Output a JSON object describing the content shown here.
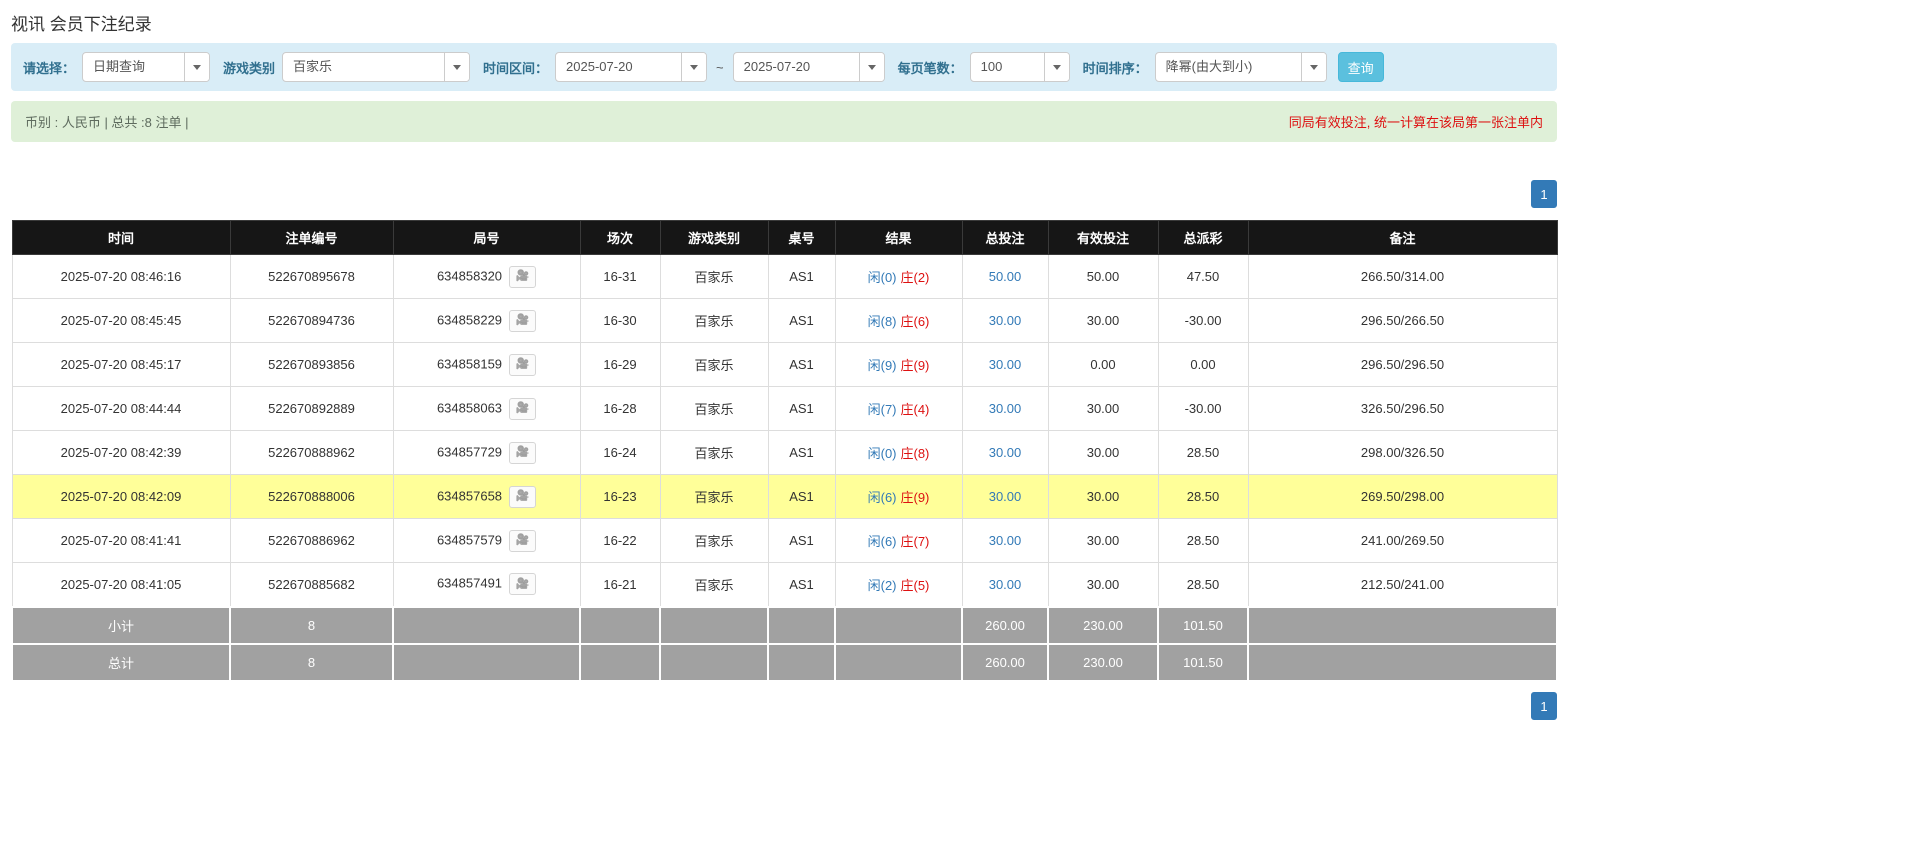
{
  "page_title": "视讯 会员下注纪录",
  "filter": {
    "select_label": "请选择：",
    "select_value": "日期查询",
    "game_type_label": "游戏类别",
    "game_type_value": "百家乐",
    "time_range_label": "时间区间：",
    "date_from": "2025-07-20",
    "tilde": "~",
    "date_to": "2025-07-20",
    "page_size_label": "每页笔数：",
    "page_size_value": "100",
    "sort_label": "时间排序：",
    "sort_value": "降幂(由大到小)",
    "search_button": "查询"
  },
  "summary": {
    "left": "币别 : 人民币 | 总共 :8 注单 |",
    "right": "同局有效投注, 统一计算在该局第一张注单内"
  },
  "pagination": {
    "page": "1"
  },
  "table": {
    "headers": [
      "时间",
      "注单编号",
      "局号",
      "场次",
      "游戏类别",
      "桌号",
      "结果",
      "总投注",
      "有效投注",
      "总派彩",
      "备注"
    ],
    "rows": [
      {
        "time": "2025-07-20 08:46:16",
        "bet_id": "522670895678",
        "round": "634858320",
        "session": "16-31",
        "game": "百家乐",
        "table_no": "AS1",
        "result_player": "闲(0)",
        "result_banker": "庄(2)",
        "total_bet": "50.00",
        "valid_bet": "50.00",
        "payout": "47.50",
        "note": "266.50/314.00",
        "highlight": false
      },
      {
        "time": "2025-07-20 08:45:45",
        "bet_id": "522670894736",
        "round": "634858229",
        "session": "16-30",
        "game": "百家乐",
        "table_no": "AS1",
        "result_player": "闲(8)",
        "result_banker": "庄(6)",
        "total_bet": "30.00",
        "valid_bet": "30.00",
        "payout": "-30.00",
        "note": "296.50/266.50",
        "highlight": false
      },
      {
        "time": "2025-07-20 08:45:17",
        "bet_id": "522670893856",
        "round": "634858159",
        "session": "16-29",
        "game": "百家乐",
        "table_no": "AS1",
        "result_player": "闲(9)",
        "result_banker": "庄(9)",
        "total_bet": "30.00",
        "valid_bet": "0.00",
        "payout": "0.00",
        "note": "296.50/296.50",
        "highlight": false
      },
      {
        "time": "2025-07-20 08:44:44",
        "bet_id": "522670892889",
        "round": "634858063",
        "session": "16-28",
        "game": "百家乐",
        "table_no": "AS1",
        "result_player": "闲(7)",
        "result_banker": "庄(4)",
        "total_bet": "30.00",
        "valid_bet": "30.00",
        "payout": "-30.00",
        "note": "326.50/296.50",
        "highlight": false
      },
      {
        "time": "2025-07-20 08:42:39",
        "bet_id": "522670888962",
        "round": "634857729",
        "session": "16-24",
        "game": "百家乐",
        "table_no": "AS1",
        "result_player": "闲(0)",
        "result_banker": "庄(8)",
        "total_bet": "30.00",
        "valid_bet": "30.00",
        "payout": "28.50",
        "note": "298.00/326.50",
        "highlight": false
      },
      {
        "time": "2025-07-20 08:42:09",
        "bet_id": "522670888006",
        "round": "634857658",
        "session": "16-23",
        "game": "百家乐",
        "table_no": "AS1",
        "result_player": "闲(6)",
        "result_banker": "庄(9)",
        "total_bet": "30.00",
        "valid_bet": "30.00",
        "payout": "28.50",
        "note": "269.50/298.00",
        "highlight": true
      },
      {
        "time": "2025-07-20 08:41:41",
        "bet_id": "522670886962",
        "round": "634857579",
        "session": "16-22",
        "game": "百家乐",
        "table_no": "AS1",
        "result_player": "闲(6)",
        "result_banker": "庄(7)",
        "total_bet": "30.00",
        "valid_bet": "30.00",
        "payout": "28.50",
        "note": "241.00/269.50",
        "highlight": false
      },
      {
        "time": "2025-07-20 08:41:05",
        "bet_id": "522670885682",
        "round": "634857491",
        "session": "16-21",
        "game": "百家乐",
        "table_no": "AS1",
        "result_player": "闲(2)",
        "result_banker": "庄(5)",
        "total_bet": "30.00",
        "valid_bet": "30.00",
        "payout": "28.50",
        "note": "212.50/241.00",
        "highlight": false
      }
    ],
    "subtotal": {
      "label": "小计",
      "count": "8",
      "total_bet": "260.00",
      "valid_bet": "230.00",
      "payout": "101.50"
    },
    "total": {
      "label": "总计",
      "count": "8",
      "total_bet": "260.00",
      "valid_bet": "230.00",
      "payout": "101.50"
    }
  },
  "icons": {
    "dropdown_caret": "chevron-down-icon",
    "round_video": "video-icon"
  },
  "colors": {
    "filter_bg": "#d9edf7",
    "summary_bg": "#dff0d8",
    "table_header_bg": "#161616",
    "highlight_row": "#ffff99",
    "footer_bg": "#a1a1a1",
    "link_blue": "#337ab7",
    "negative_red": "#dd1111",
    "search_button_blue": "#5bc0de",
    "pagination_blue": "#337ab7"
  }
}
